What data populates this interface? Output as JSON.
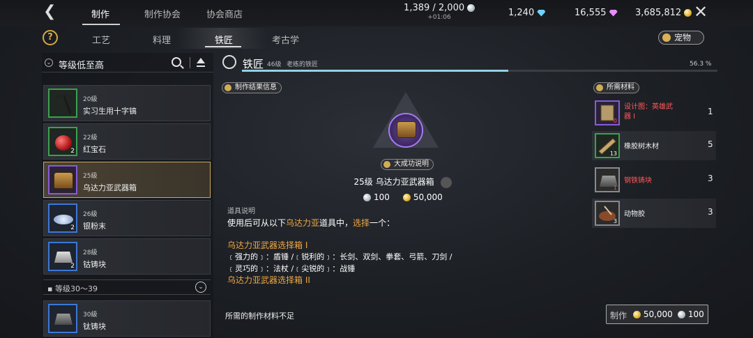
{
  "topbar": {
    "tabs": [
      "制作",
      "制作协会",
      "协会商店"
    ],
    "energy": "1,389 / 2,000",
    "energy_timer": "+01:06",
    "blue_gems": "1,240",
    "pink_gems": "16,555",
    "gold": "3,685,812"
  },
  "subnav": {
    "tabs": [
      "工艺",
      "料理",
      "铁匠",
      "考古学"
    ],
    "active": "铁匠",
    "pet_label": "宠物"
  },
  "list": {
    "sort_label": "等级低至高",
    "items": [
      {
        "level": "20級",
        "name": "实习生用十字镐",
        "count": ""
      },
      {
        "level": "22級",
        "name": "红宝石",
        "count": "2"
      },
      {
        "level": "25級",
        "name": "乌达力亚武器箱",
        "count": ""
      },
      {
        "level": "26級",
        "name": "银粉末",
        "count": "2"
      },
      {
        "level": "28級",
        "name": "钴铸块",
        "count": "2"
      },
      {
        "level": "30級",
        "name": "钛铸块",
        "count": ""
      }
    ],
    "group_label": "等级30～39"
  },
  "craft_header": {
    "title": "铁匠",
    "level": "46级",
    "rank": "老练的铁匠",
    "percent": "56.3 %",
    "progress": 0.56
  },
  "detail": {
    "result_info_label": "制作结果信息",
    "success_info_label": "大成功说明",
    "item_title": "25级  乌达力亚武器箱",
    "silver_cost": "100",
    "gold_cost": "50,000",
    "desc_label": "道具说明",
    "desc_line1_a": "使用后可从以下",
    "desc_line1_b": "乌达力亚",
    "desc_line1_c": "道具中，",
    "desc_line1_d": "选择",
    "desc_line1_e": "一个：",
    "box1": "乌达力亚武器选择箱 I",
    "box1_l1": "﹝强力的﹞：盾锤 /﹝锐利的﹞：长剑、双剑、拳套、弓箭、刀剑 /",
    "box1_l2": "﹝灵巧的﹞：法杖 /﹝尖锐的﹞：战锤",
    "box2": "乌达力亚武器选择箱 II",
    "not_enough": "所需的制作材料不足"
  },
  "materials": {
    "label": "所需材料",
    "items": [
      {
        "name": "设计图：英雄武器 I",
        "qty": "1",
        "count": "0"
      },
      {
        "name": "橡胶树木材",
        "qty": "5",
        "count": "13"
      },
      {
        "name": "钢铁铸块",
        "qty": "3",
        "count": "1"
      },
      {
        "name": "动物胶",
        "qty": "3",
        "count": "3"
      }
    ]
  },
  "craft_button": {
    "label": "制作",
    "gold": "50,000",
    "silver": "100"
  }
}
